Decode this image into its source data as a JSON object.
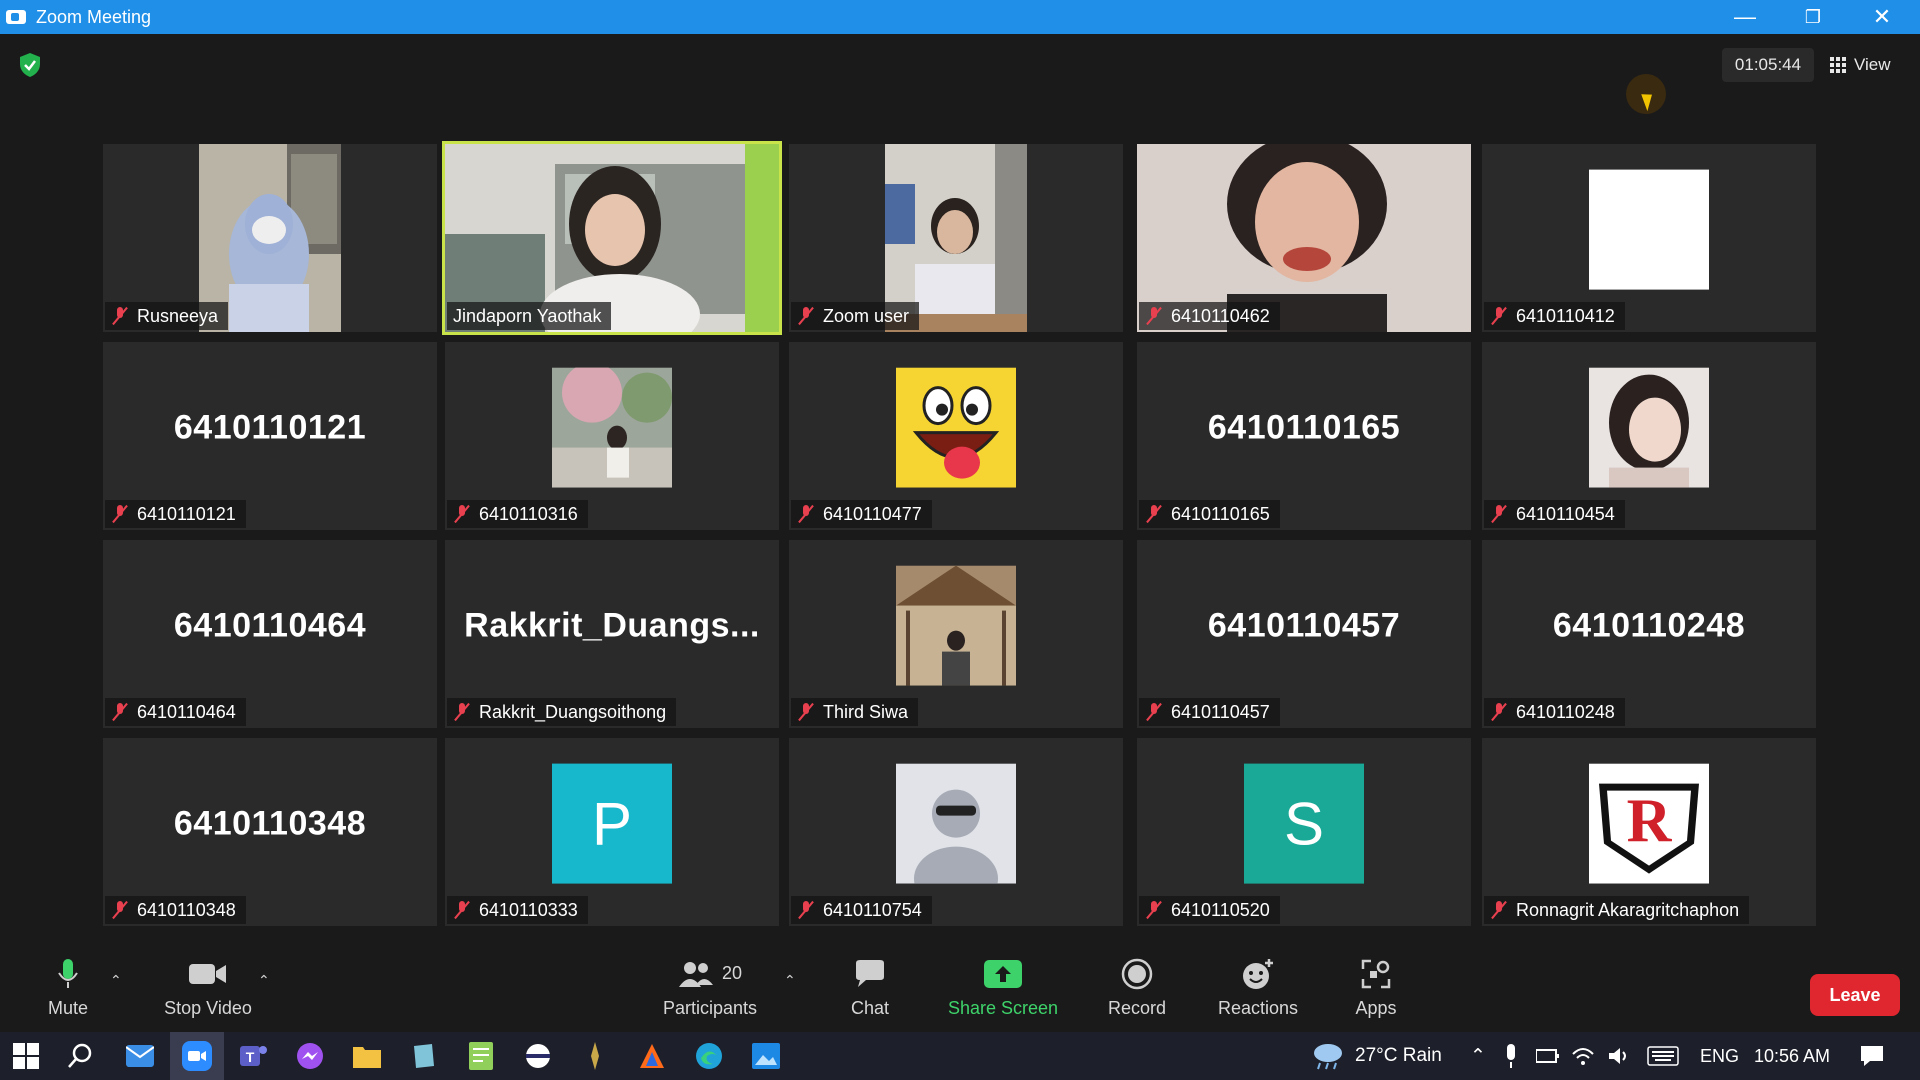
{
  "window": {
    "title": "Zoom Meeting"
  },
  "header": {
    "timer": "01:05:44",
    "view_label": "View"
  },
  "participants": [
    {
      "name": "Rusneeya",
      "display": "photo"
    },
    {
      "name": "Jindaporn Yaothak",
      "display": "photo",
      "active_speaker": true
    },
    {
      "name": "Zoom user",
      "display": "photo"
    },
    {
      "name": "6410110462",
      "display": "photo"
    },
    {
      "name": "6410110412",
      "display": "blank-avatar"
    },
    {
      "name": "6410110121",
      "display": "name",
      "tile_text": "6410110121"
    },
    {
      "name": "6410110316",
      "display": "photo"
    },
    {
      "name": "6410110477",
      "display": "emoji-avatar"
    },
    {
      "name": "6410110165",
      "display": "name",
      "tile_text": "6410110165"
    },
    {
      "name": "6410110454",
      "display": "photo"
    },
    {
      "name": "6410110464",
      "display": "name",
      "tile_text": "6410110464"
    },
    {
      "name": "Rakkrit_Duangsoithong",
      "display": "name",
      "tile_text": "Rakkrit_Duangs..."
    },
    {
      "name": "Third Siwa",
      "display": "photo"
    },
    {
      "name": "6410110457",
      "display": "name",
      "tile_text": "6410110457"
    },
    {
      "name": "6410110248",
      "display": "name",
      "tile_text": "6410110248"
    },
    {
      "name": "6410110348",
      "display": "name",
      "tile_text": "6410110348"
    },
    {
      "name": "6410110333",
      "display": "letter-avatar",
      "avatar_letter": "P",
      "avatar_color": "#17b8cc"
    },
    {
      "name": "6410110754",
      "display": "default-avatar"
    },
    {
      "name": "6410110520",
      "display": "letter-avatar",
      "avatar_letter": "S",
      "avatar_color": "#1aa997"
    },
    {
      "name": "Ronnagrit Akaragritchaphon",
      "display": "logo-avatar",
      "avatar_letter": "R"
    }
  ],
  "controls": {
    "mute": "Mute",
    "stop_video": "Stop Video",
    "participants": "Participants",
    "participants_count": "20",
    "chat": "Chat",
    "share_screen": "Share Screen",
    "record": "Record",
    "reactions": "Reactions",
    "apps": "Apps",
    "leave": "Leave"
  },
  "taskbar": {
    "weather": "27°C  Rain",
    "language": "ENG",
    "time": "10:56 AM"
  },
  "colors": {
    "titlebar": "#1f8fe8",
    "active_speaker": "#c9e34a",
    "share_green": "#3ed36a",
    "leave_red": "#e0272f",
    "muted_red": "#e8404f"
  }
}
